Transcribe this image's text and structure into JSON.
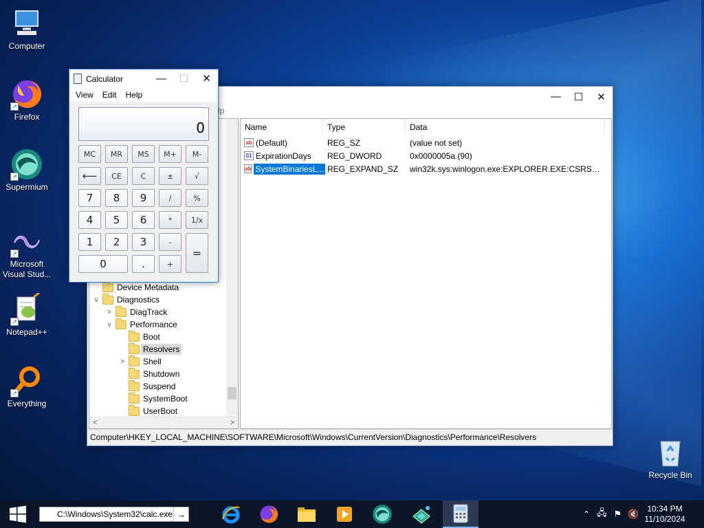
{
  "desktop": {
    "icons": [
      {
        "label": "Computer"
      },
      {
        "label": "Firefox"
      },
      {
        "label": "Supermium"
      },
      {
        "label": "Microsoft Visual Stud..."
      },
      {
        "label": "Notepad++"
      },
      {
        "label": "Everything"
      },
      {
        "label": "Recycle Bin"
      }
    ]
  },
  "calculator": {
    "title": "Calculator",
    "menu": [
      "View",
      "Edit",
      "Help"
    ],
    "display": "0",
    "memory_row": [
      "MC",
      "MR",
      "MS",
      "M+",
      "M-"
    ],
    "row2": [
      "⟵",
      "CE",
      "C",
      "±",
      "√"
    ],
    "row3": [
      "7",
      "8",
      "9",
      "/",
      "%"
    ],
    "row4": [
      "4",
      "5",
      "6",
      "*",
      "1/x"
    ],
    "row5": [
      "1",
      "2",
      "3",
      "-",
      "="
    ],
    "row6": [
      "0",
      ".",
      "+"
    ]
  },
  "regedit": {
    "menu_partial": "lp",
    "columns": [
      "Name",
      "Type",
      "Data"
    ],
    "values": [
      {
        "name": "(Default)",
        "type": "REG_SZ",
        "data": "(value not set)",
        "icon": "string-value-icon"
      },
      {
        "name": "ExpirationDays",
        "type": "REG_DWORD",
        "data": "0x0000005a (90)",
        "icon": "binary-value-icon"
      },
      {
        "name": "SystemBinariesL...",
        "type": "REG_EXPAND_SZ",
        "data": "win32k.sys:winlogon.exe:EXPLORER.EXE:CSRSS.Exe...",
        "icon": "string-value-icon"
      }
    ],
    "tree": [
      {
        "label": "Device Metadata",
        "expander": ""
      },
      {
        "label": "Diagnostics",
        "expander": "v"
      },
      {
        "label": "DiagTrack",
        "expander": ">"
      },
      {
        "label": "Performance",
        "expander": "v"
      },
      {
        "label": "Boot",
        "expander": ""
      },
      {
        "label": "Resolvers",
        "expander": ""
      },
      {
        "label": "Shell",
        "expander": ">"
      },
      {
        "label": "Shutdown",
        "expander": ""
      },
      {
        "label": "Suspend",
        "expander": ""
      },
      {
        "label": "SystemBoot",
        "expander": ""
      },
      {
        "label": "UserBoot",
        "expander": ""
      }
    ],
    "status": "Computer\\HKEY_LOCAL_MACHINE\\SOFTWARE\\Microsoft\\Windows\\CurrentVersion\\Diagnostics\\Performance\\Resolvers"
  },
  "taskbar": {
    "run_value": "C:\\Windows\\System32\\calc.exe",
    "apps": [
      "internet-explorer",
      "firefox",
      "file-explorer",
      "media-player",
      "supermium",
      "network-app",
      "calculator"
    ],
    "time": "10:34 PM",
    "date": "11/10/2024"
  },
  "colors": {
    "accent": "#0078d7",
    "taskbar": "#0b1629"
  }
}
